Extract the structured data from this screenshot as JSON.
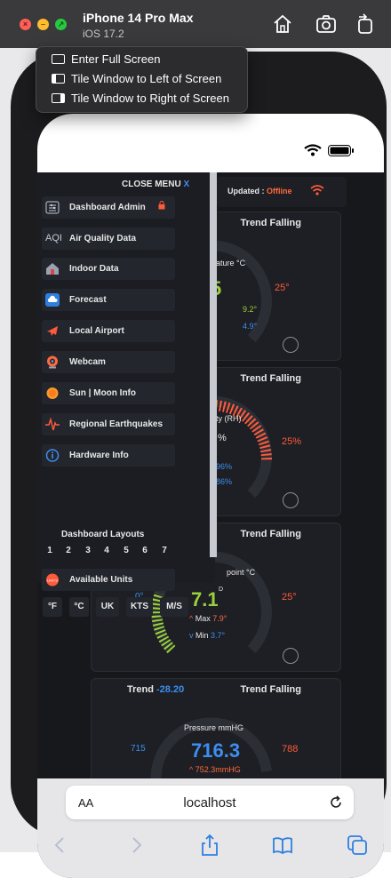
{
  "window": {
    "title": "iPhone 14 Pro Max",
    "subtitle": "iOS 17.2",
    "traffic_lights": {
      "close": "#ff5f57",
      "minimize": "#febc2e",
      "zoom": "#28c840"
    }
  },
  "context_menu": {
    "items": [
      {
        "label": "Enter Full Screen",
        "icon": "fullscreen-icon"
      },
      {
        "label": "Tile Window to Left of Screen",
        "icon": "tile-left-icon"
      },
      {
        "label": "Tile Window to Right of Screen",
        "icon": "tile-right-icon"
      }
    ]
  },
  "header": {
    "updated_label": "Updated :",
    "updated_status": "Offline"
  },
  "side_menu": {
    "close_label": "CLOSE MENU",
    "close_x": "X",
    "items": [
      {
        "label": "Dashboard Admin",
        "icon": "sliders-icon"
      },
      {
        "label": "Air Quality Data",
        "icon": "aqi-icon",
        "icon_text": "AQI"
      },
      {
        "label": "Indoor Data",
        "icon": "house-icon"
      },
      {
        "label": "Forecast",
        "icon": "cloud-icon"
      },
      {
        "label": "Local Airport",
        "icon": "airplane-icon"
      },
      {
        "label": "Webcam",
        "icon": "webcam-icon"
      },
      {
        "label": "Sun | Moon Info",
        "icon": "sun-icon"
      },
      {
        "label": "Regional Earthquakes",
        "icon": "seismograph-icon"
      },
      {
        "label": "Hardware Info",
        "icon": "info-icon"
      }
    ],
    "layouts_title": "Dashboard Layouts",
    "layouts": [
      "1",
      "2",
      "3",
      "4",
      "5",
      "6",
      "7"
    ],
    "available_units": {
      "label": "Available Units",
      "icon": "units-icon",
      "icon_text": "UNITS"
    },
    "units": [
      "°F",
      "°C",
      "UK",
      "KTS",
      "M/S"
    ]
  },
  "cards": {
    "temperature": {
      "trend_status": "Trend Falling",
      "label_fragment": "ature °C",
      "value_fragment": "5",
      "max_fragment": "9.2°",
      "min_fragment": "4.9°",
      "high": "25°"
    },
    "humidity": {
      "trend_status": "Trend Falling",
      "label_fragment": "ty (RH)",
      "value_fragment": "%",
      "max_fragment": "96%",
      "min_fragment": "86%",
      "high": "25%"
    },
    "dewpoint": {
      "trend_status": "Trend Falling",
      "label_fragment": "point °C",
      "value": "7.1",
      "value_unit": "D",
      "max_label": "Max",
      "max_value": "7.9°",
      "min_label": "Min",
      "min_value": "3.7°",
      "low": "0°",
      "high": "25°"
    },
    "pressure": {
      "trend_label": "Trend",
      "trend_value": "-28.20",
      "trend_status": "Trend Falling",
      "label": "Pressure mmHG",
      "value": "716.3",
      "max_value": "752.3mmHG",
      "low": "715",
      "high": "788"
    }
  },
  "safari": {
    "aa_label": "AA",
    "url": "localhost"
  }
}
